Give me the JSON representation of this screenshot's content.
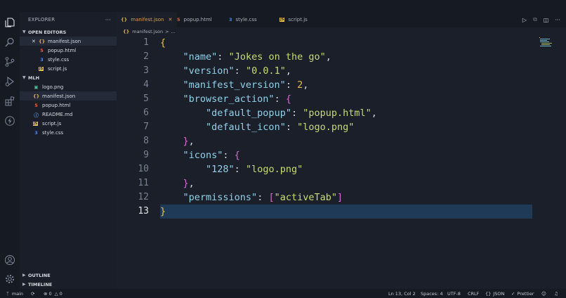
{
  "colors": {
    "background": "#1b1f2a",
    "sidebar": "#1a1e28",
    "activity_bar": "#161a23",
    "active_tab_text": "#d9a14a",
    "line_highlight": "#1f3a57",
    "json_key": "#8fd2e9",
    "json_string": "#c8dc73",
    "json_number": "#e5bc52"
  },
  "explorer": {
    "title": "EXPLORER",
    "more": "···",
    "open_editors": {
      "label": "OPEN EDITORS",
      "items": [
        {
          "name": "manifest.json",
          "icon": "json-icon",
          "active": true
        },
        {
          "name": "popup.html",
          "icon": "html-icon"
        },
        {
          "name": "style.css",
          "icon": "css-icon"
        },
        {
          "name": "script.js",
          "icon": "js-icon"
        }
      ]
    },
    "folder": {
      "label": "MLH",
      "items": [
        {
          "name": "logo.png",
          "icon": "image-icon"
        },
        {
          "name": "manifest.json",
          "icon": "json-icon",
          "active": true
        },
        {
          "name": "popup.html",
          "icon": "html-icon"
        },
        {
          "name": "README.md",
          "icon": "info-icon"
        },
        {
          "name": "script.js",
          "icon": "js-icon"
        },
        {
          "name": "style.css",
          "icon": "css-icon"
        }
      ]
    },
    "outline": "OUTLINE",
    "timeline": "TIMELINE"
  },
  "tabs": [
    {
      "label": "manifest.json",
      "icon": "json-icon",
      "active": true
    },
    {
      "label": "popup.html",
      "icon": "html-icon"
    },
    {
      "label": "style.css",
      "icon": "css-icon"
    },
    {
      "label": "script.js",
      "icon": "js-icon"
    }
  ],
  "breadcrumb": {
    "file": "manifest.json",
    "sep": ">",
    "rest": "..."
  },
  "editor": {
    "current_line": 13,
    "lines": [
      "1",
      "2",
      "3",
      "4",
      "5",
      "6",
      "7",
      "8",
      "9",
      "10",
      "11",
      "12",
      "13"
    ],
    "code": {
      "l1_brace": "{",
      "l2_key": "\"name\"",
      "l2_val": "\"Jokes on the go\"",
      "l3_key": "\"version\"",
      "l3_val": "\"0.0.1\"",
      "l4_key": "\"manifest_version\"",
      "l4_val": "2",
      "l5_key": "\"browser_action\"",
      "l5_open": "{",
      "l6_key": "\"default_popup\"",
      "l6_val": "\"popup.html\"",
      "l7_key": "\"default_icon\"",
      "l7_val": "\"logo.png\"",
      "l8_close": "}",
      "l9_key": "\"icons\"",
      "l9_open": "{",
      "l10_key": "\"128\"",
      "l10_val": "\"logo.png\"",
      "l11_close": "}",
      "l12_key": "\"permissions\"",
      "l12_open": "[",
      "l12_val": "\"activeTab\"",
      "l12_close": "]",
      "l13_brace": "}",
      "colon": ": ",
      "comma": ","
    }
  },
  "status": {
    "branch": "main",
    "errors": "0",
    "warnings": "0",
    "position": "Ln 13, Col 2",
    "spaces": "Spaces: 4",
    "encoding": "UTF-8",
    "eol": "CRLF",
    "language": "JSON",
    "formatter": "Prettier"
  }
}
